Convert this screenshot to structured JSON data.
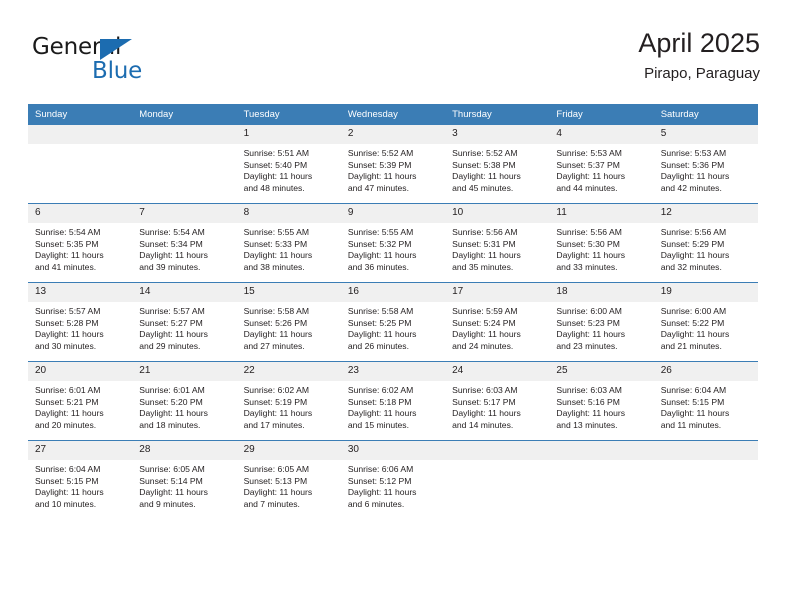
{
  "brand": {
    "name_top": "General",
    "name_bottom": "Blue",
    "accent_color": "#1c6cb0"
  },
  "header": {
    "title": "April 2025",
    "subtitle": "Pirapo, Paraguay"
  },
  "theme": {
    "header_blue": "#3b7db5",
    "daynum_band": "#f0f0f0",
    "text": "#231f20"
  },
  "weekday_headers": [
    "Sunday",
    "Monday",
    "Tuesday",
    "Wednesday",
    "Thursday",
    "Friday",
    "Saturday"
  ],
  "labels": {
    "sunrise_prefix": "Sunrise:",
    "sunset_prefix": "Sunset:",
    "daylight_prefix": "Daylight:"
  },
  "weeks": [
    [
      {
        "day": "",
        "sunrise": "",
        "sunset": "",
        "daylight_1": "",
        "daylight_2": ""
      },
      {
        "day": "",
        "sunrise": "",
        "sunset": "",
        "daylight_1": "",
        "daylight_2": ""
      },
      {
        "day": "1",
        "sunrise": "Sunrise: 5:51 AM",
        "sunset": "Sunset: 5:40 PM",
        "daylight_1": "Daylight: 11 hours",
        "daylight_2": "and 48 minutes."
      },
      {
        "day": "2",
        "sunrise": "Sunrise: 5:52 AM",
        "sunset": "Sunset: 5:39 PM",
        "daylight_1": "Daylight: 11 hours",
        "daylight_2": "and 47 minutes."
      },
      {
        "day": "3",
        "sunrise": "Sunrise: 5:52 AM",
        "sunset": "Sunset: 5:38 PM",
        "daylight_1": "Daylight: 11 hours",
        "daylight_2": "and 45 minutes."
      },
      {
        "day": "4",
        "sunrise": "Sunrise: 5:53 AM",
        "sunset": "Sunset: 5:37 PM",
        "daylight_1": "Daylight: 11 hours",
        "daylight_2": "and 44 minutes."
      },
      {
        "day": "5",
        "sunrise": "Sunrise: 5:53 AM",
        "sunset": "Sunset: 5:36 PM",
        "daylight_1": "Daylight: 11 hours",
        "daylight_2": "and 42 minutes."
      }
    ],
    [
      {
        "day": "6",
        "sunrise": "Sunrise: 5:54 AM",
        "sunset": "Sunset: 5:35 PM",
        "daylight_1": "Daylight: 11 hours",
        "daylight_2": "and 41 minutes."
      },
      {
        "day": "7",
        "sunrise": "Sunrise: 5:54 AM",
        "sunset": "Sunset: 5:34 PM",
        "daylight_1": "Daylight: 11 hours",
        "daylight_2": "and 39 minutes."
      },
      {
        "day": "8",
        "sunrise": "Sunrise: 5:55 AM",
        "sunset": "Sunset: 5:33 PM",
        "daylight_1": "Daylight: 11 hours",
        "daylight_2": "and 38 minutes."
      },
      {
        "day": "9",
        "sunrise": "Sunrise: 5:55 AM",
        "sunset": "Sunset: 5:32 PM",
        "daylight_1": "Daylight: 11 hours",
        "daylight_2": "and 36 minutes."
      },
      {
        "day": "10",
        "sunrise": "Sunrise: 5:56 AM",
        "sunset": "Sunset: 5:31 PM",
        "daylight_1": "Daylight: 11 hours",
        "daylight_2": "and 35 minutes."
      },
      {
        "day": "11",
        "sunrise": "Sunrise: 5:56 AM",
        "sunset": "Sunset: 5:30 PM",
        "daylight_1": "Daylight: 11 hours",
        "daylight_2": "and 33 minutes."
      },
      {
        "day": "12",
        "sunrise": "Sunrise: 5:56 AM",
        "sunset": "Sunset: 5:29 PM",
        "daylight_1": "Daylight: 11 hours",
        "daylight_2": "and 32 minutes."
      }
    ],
    [
      {
        "day": "13",
        "sunrise": "Sunrise: 5:57 AM",
        "sunset": "Sunset: 5:28 PM",
        "daylight_1": "Daylight: 11 hours",
        "daylight_2": "and 30 minutes."
      },
      {
        "day": "14",
        "sunrise": "Sunrise: 5:57 AM",
        "sunset": "Sunset: 5:27 PM",
        "daylight_1": "Daylight: 11 hours",
        "daylight_2": "and 29 minutes."
      },
      {
        "day": "15",
        "sunrise": "Sunrise: 5:58 AM",
        "sunset": "Sunset: 5:26 PM",
        "daylight_1": "Daylight: 11 hours",
        "daylight_2": "and 27 minutes."
      },
      {
        "day": "16",
        "sunrise": "Sunrise: 5:58 AM",
        "sunset": "Sunset: 5:25 PM",
        "daylight_1": "Daylight: 11 hours",
        "daylight_2": "and 26 minutes."
      },
      {
        "day": "17",
        "sunrise": "Sunrise: 5:59 AM",
        "sunset": "Sunset: 5:24 PM",
        "daylight_1": "Daylight: 11 hours",
        "daylight_2": "and 24 minutes."
      },
      {
        "day": "18",
        "sunrise": "Sunrise: 6:00 AM",
        "sunset": "Sunset: 5:23 PM",
        "daylight_1": "Daylight: 11 hours",
        "daylight_2": "and 23 minutes."
      },
      {
        "day": "19",
        "sunrise": "Sunrise: 6:00 AM",
        "sunset": "Sunset: 5:22 PM",
        "daylight_1": "Daylight: 11 hours",
        "daylight_2": "and 21 minutes."
      }
    ],
    [
      {
        "day": "20",
        "sunrise": "Sunrise: 6:01 AM",
        "sunset": "Sunset: 5:21 PM",
        "daylight_1": "Daylight: 11 hours",
        "daylight_2": "and 20 minutes."
      },
      {
        "day": "21",
        "sunrise": "Sunrise: 6:01 AM",
        "sunset": "Sunset: 5:20 PM",
        "daylight_1": "Daylight: 11 hours",
        "daylight_2": "and 18 minutes."
      },
      {
        "day": "22",
        "sunrise": "Sunrise: 6:02 AM",
        "sunset": "Sunset: 5:19 PM",
        "daylight_1": "Daylight: 11 hours",
        "daylight_2": "and 17 minutes."
      },
      {
        "day": "23",
        "sunrise": "Sunrise: 6:02 AM",
        "sunset": "Sunset: 5:18 PM",
        "daylight_1": "Daylight: 11 hours",
        "daylight_2": "and 15 minutes."
      },
      {
        "day": "24",
        "sunrise": "Sunrise: 6:03 AM",
        "sunset": "Sunset: 5:17 PM",
        "daylight_1": "Daylight: 11 hours",
        "daylight_2": "and 14 minutes."
      },
      {
        "day": "25",
        "sunrise": "Sunrise: 6:03 AM",
        "sunset": "Sunset: 5:16 PM",
        "daylight_1": "Daylight: 11 hours",
        "daylight_2": "and 13 minutes."
      },
      {
        "day": "26",
        "sunrise": "Sunrise: 6:04 AM",
        "sunset": "Sunset: 5:15 PM",
        "daylight_1": "Daylight: 11 hours",
        "daylight_2": "and 11 minutes."
      }
    ],
    [
      {
        "day": "27",
        "sunrise": "Sunrise: 6:04 AM",
        "sunset": "Sunset: 5:15 PM",
        "daylight_1": "Daylight: 11 hours",
        "daylight_2": "and 10 minutes."
      },
      {
        "day": "28",
        "sunrise": "Sunrise: 6:05 AM",
        "sunset": "Sunset: 5:14 PM",
        "daylight_1": "Daylight: 11 hours",
        "daylight_2": "and 9 minutes."
      },
      {
        "day": "29",
        "sunrise": "Sunrise: 6:05 AM",
        "sunset": "Sunset: 5:13 PM",
        "daylight_1": "Daylight: 11 hours",
        "daylight_2": "and 7 minutes."
      },
      {
        "day": "30",
        "sunrise": "Sunrise: 6:06 AM",
        "sunset": "Sunset: 5:12 PM",
        "daylight_1": "Daylight: 11 hours",
        "daylight_2": "and 6 minutes."
      },
      {
        "day": "",
        "sunrise": "",
        "sunset": "",
        "daylight_1": "",
        "daylight_2": ""
      },
      {
        "day": "",
        "sunrise": "",
        "sunset": "",
        "daylight_1": "",
        "daylight_2": ""
      },
      {
        "day": "",
        "sunrise": "",
        "sunset": "",
        "daylight_1": "",
        "daylight_2": ""
      }
    ]
  ]
}
